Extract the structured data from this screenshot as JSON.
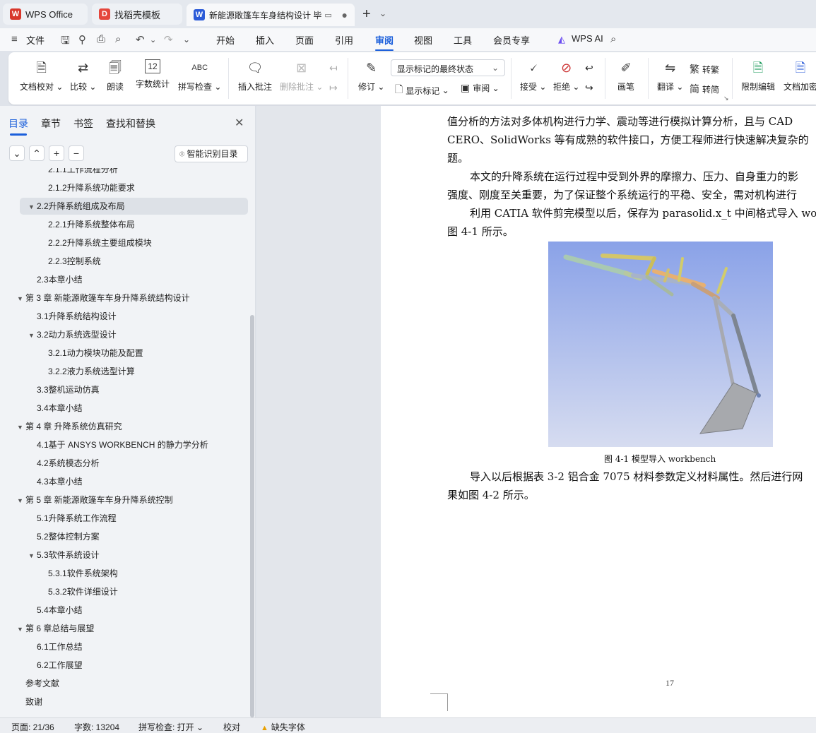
{
  "tabs": [
    {
      "label": "WPS Office",
      "icon": "wps-logo-icon",
      "color": "#d8372b"
    },
    {
      "label": "找稻壳模板",
      "icon": "docer-logo-icon",
      "color": "#e5463c"
    },
    {
      "label": "新能源敞篷车车身结构设计 毕",
      "icon": "word-doc-icon",
      "color": "#2b5bd8"
    }
  ],
  "menu": {
    "file": "文件",
    "items": [
      "开始",
      "插入",
      "页面",
      "引用",
      "审阅",
      "视图",
      "工具",
      "会员专享"
    ],
    "active": "审阅",
    "wps_ai": "WPS AI"
  },
  "ribbon": {
    "doc_check": "文档校对",
    "compare": "比较",
    "read_aloud": "朗读",
    "word_count": "字数统计",
    "spell_check": "拼写检查",
    "insert_comment": "插入批注",
    "delete_comment": "删除批注",
    "revise": "修订",
    "markup_state": "显示标记的最终状态",
    "show_markup": "显示标记",
    "review": "审阅",
    "accept": "接受",
    "reject": "拒绝",
    "pen": "画笔",
    "translate": "翻译",
    "to_traditional": "转繁",
    "to_simplified": "转简",
    "restrict_edit": "限制编辑",
    "doc_encrypt": "文档加密",
    "abc_label": "ABC",
    "count_label": "12"
  },
  "leftpanel": {
    "tabs": [
      "目录",
      "章节",
      "书签",
      "查找和替换"
    ],
    "smart_toc": "智能识别目录",
    "toc": [
      {
        "label": "2.1.1工作流程分析",
        "level": 3,
        "expander": ""
      },
      {
        "label": "2.1.2升降系统功能要求",
        "level": 3,
        "expander": ""
      },
      {
        "label": "2.2升降系统组成及布局",
        "level": 2,
        "expander": "▼",
        "selected": true
      },
      {
        "label": "2.2.1升降系统整体布局",
        "level": 3,
        "expander": ""
      },
      {
        "label": "2.2.2升降系统主要组成模块",
        "level": 3,
        "expander": ""
      },
      {
        "label": "2.2.3控制系统",
        "level": 3,
        "expander": ""
      },
      {
        "label": "2.3本章小结",
        "level": 2,
        "expander": ""
      },
      {
        "label": "第 3 章 新能源敞篷车车身升降系统结构设计",
        "level": 1,
        "expander": "▼"
      },
      {
        "label": "3.1升降系统结构设计",
        "level": 2,
        "expander": ""
      },
      {
        "label": "3.2动力系统选型设计",
        "level": 2,
        "expander": "▼"
      },
      {
        "label": "3.2.1动力模块功能及配置",
        "level": 3,
        "expander": ""
      },
      {
        "label": "3.2.2液力系统选型计算",
        "level": 3,
        "expander": ""
      },
      {
        "label": "3.3整机运动仿真",
        "level": 2,
        "expander": ""
      },
      {
        "label": "3.4本章小结",
        "level": 2,
        "expander": ""
      },
      {
        "label": "第 4 章 升降系统仿真研究",
        "level": 1,
        "expander": "▼"
      },
      {
        "label": "4.1基于 ANSYS WORKBENCH 的静力学分析",
        "level": 2,
        "expander": ""
      },
      {
        "label": "4.2系统模态分析",
        "level": 2,
        "expander": ""
      },
      {
        "label": "4.3本章小结",
        "level": 2,
        "expander": ""
      },
      {
        "label": "第 5 章 新能源敞篷车车身升降系统控制",
        "level": 1,
        "expander": "▼"
      },
      {
        "label": "5.1升降系统工作流程",
        "level": 2,
        "expander": ""
      },
      {
        "label": "5.2整体控制方案",
        "level": 2,
        "expander": ""
      },
      {
        "label": "5.3软件系统设计",
        "level": 2,
        "expander": "▼"
      },
      {
        "label": "5.3.1软件系统架构",
        "level": 3,
        "expander": ""
      },
      {
        "label": "5.3.2软件详细设计",
        "level": 3,
        "expander": ""
      },
      {
        "label": "5.4本章小结",
        "level": 2,
        "expander": ""
      },
      {
        "label": "第 6 章总结与展望",
        "level": 1,
        "expander": "▼"
      },
      {
        "label": "6.1工作总结",
        "level": 2,
        "expander": ""
      },
      {
        "label": "6.2工作展望",
        "level": 2,
        "expander": ""
      },
      {
        "label": "参考文献",
        "level": 1,
        "expander": ""
      },
      {
        "label": "致谢",
        "level": 1,
        "expander": ""
      }
    ]
  },
  "document": {
    "lines": [
      {
        "text": "值分析的方法对多体机构进行力学、震动等进行模拟计算分析，且与 CAD",
        "indent": false
      },
      {
        "text": "CERO、SolidWorks 等有成熟的软件接口，方便工程师进行快速解决复杂的",
        "indent": false
      },
      {
        "text": "题。",
        "indent": false
      },
      {
        "text": "本文的升降系统在运行过程中受到外界的摩擦力、压力、自身重力的影",
        "indent": true
      },
      {
        "text": "强度、刚度至关重要，为了保证整个系统运行的平稳、安全，需对机构进行",
        "indent": false
      },
      {
        "text": "利用 CATIA 软件剪完模型以后，保存为 parasolid.x_t 中间格式导入 wo",
        "indent": true
      },
      {
        "text": "图 4-1 所示。",
        "indent": false
      }
    ],
    "figure_caption": "图 4-1 模型导入 workbench",
    "after_lines": [
      {
        "text": "导入以后根据表 3-2 铝合金 7075 材料参数定义材料属性。然后进行网",
        "indent": true
      },
      {
        "text": "果如图 4-2 所示。",
        "indent": false
      }
    ],
    "page_number": "17"
  },
  "status": {
    "page": "页面: 21/36",
    "words": "字数: 13204",
    "spell": "拼写检查: 打开",
    "proof": "校对",
    "missing_font": "缺失字体"
  },
  "colors": {
    "accent": "#1b5fdb"
  }
}
